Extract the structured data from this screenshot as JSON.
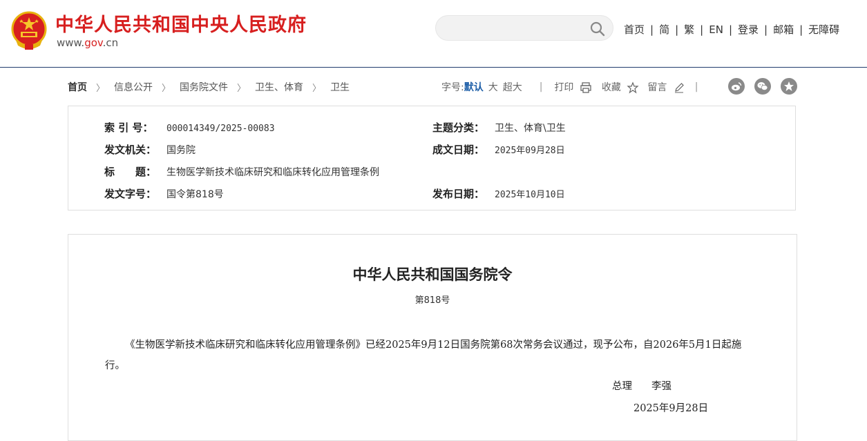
{
  "header": {
    "site_title": "中华人民共和国中央人民政府",
    "site_url_prefix": "www.",
    "site_url_gov": "gov",
    "site_url_suffix": ".cn",
    "search_placeholder": "",
    "nav": [
      "首页",
      "简",
      "繁",
      "EN",
      "登录",
      "邮箱",
      "无障碍"
    ],
    "nav_separator": "|"
  },
  "breadcrumb": [
    "首页",
    "信息公开",
    "国务院文件",
    "卫生、体育",
    "卫生"
  ],
  "tools": {
    "font_size_label": "字号:",
    "font_default": "默认",
    "font_large": "大",
    "font_xlarge": "超大",
    "separator": "|",
    "print": "打印",
    "favorite": "收藏",
    "comment": "留言"
  },
  "share_icons": [
    "weibo-icon",
    "wechat-icon",
    "favorite-star-icon"
  ],
  "meta": {
    "index_no_label": "索 引 号：",
    "index_no": "000014349/2025-00083",
    "topic_label": "主题分类：",
    "topic": "卫生、体育\\卫生",
    "issuer_label": "发文机关：",
    "issuer": "国务院",
    "written_date_label": "成文日期：",
    "written_date": "2025年09月28日",
    "title_label": "标　　题：",
    "title": "生物医学新技术临床研究和临床转化应用管理条例",
    "doc_no_label": "发文字号：",
    "doc_no": "国令第818号",
    "publish_date_label": "发布日期：",
    "publish_date": "2025年10月10日"
  },
  "document": {
    "title": "中华人民共和国国务院令",
    "number": "第818号",
    "body": "《生物医学新技术临床研究和临床转化应用管理条例》已经2025年9月12日国务院第68次常务会议通过，现予公布，自2026年5月1日起施行。",
    "signer_title": "总理",
    "signer_name": "李强",
    "date": "2025年9月28日"
  },
  "colors": {
    "brand_red": "#d71f1f",
    "accent_blue": "#1f5fa8",
    "header_line": "#1f3a6b"
  }
}
